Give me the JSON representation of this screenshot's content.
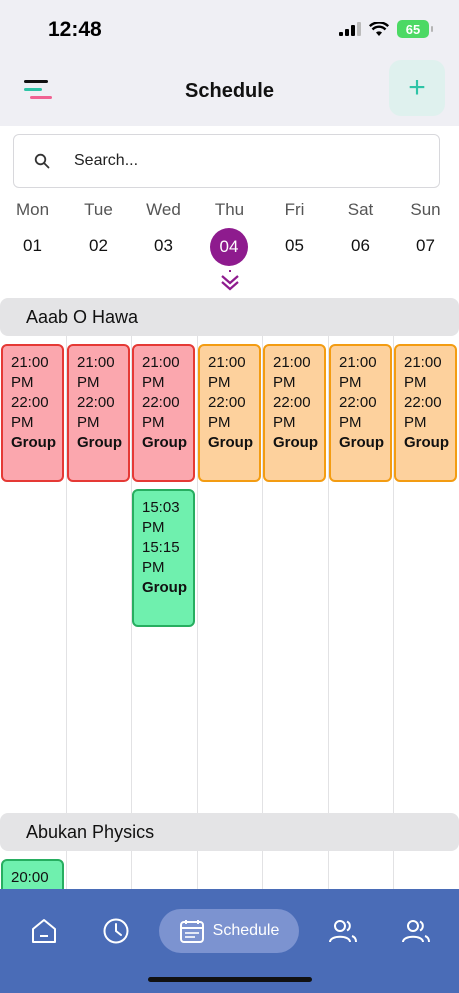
{
  "status": {
    "time": "12:48",
    "battery": "65"
  },
  "header": {
    "title": "Schedule",
    "add_label": "+"
  },
  "search": {
    "placeholder": "Search..."
  },
  "week": {
    "days": [
      {
        "name": "Mon",
        "num": "01"
      },
      {
        "name": "Tue",
        "num": "02"
      },
      {
        "name": "Wed",
        "num": "03"
      },
      {
        "name": "Thu",
        "num": "04"
      },
      {
        "name": "Fri",
        "num": "05"
      },
      {
        "name": "Sat",
        "num": "06"
      },
      {
        "name": "Sun",
        "num": "07"
      }
    ],
    "selected_index": 3
  },
  "groups": [
    {
      "name": "Aaab O Hawa",
      "events": [
        {
          "day": 0,
          "start": "21:00",
          "start_ampm": "PM",
          "end": "22:00",
          "end_ampm": "PM",
          "type": "Group",
          "color": "red"
        },
        {
          "day": 1,
          "start": "21:00",
          "start_ampm": "PM",
          "end": "22:00",
          "end_ampm": "PM",
          "type": "Group",
          "color": "red"
        },
        {
          "day": 2,
          "start": "21:00",
          "start_ampm": "PM",
          "end": "22:00",
          "end_ampm": "PM",
          "type": "Group",
          "color": "red"
        },
        {
          "day": 3,
          "start": "21:00",
          "start_ampm": "PM",
          "end": "22:00",
          "end_ampm": "PM",
          "type": "Group",
          "color": "orange"
        },
        {
          "day": 4,
          "start": "21:00",
          "start_ampm": "PM",
          "end": "22:00",
          "end_ampm": "PM",
          "type": "Group",
          "color": "orange"
        },
        {
          "day": 5,
          "start": "21:00",
          "start_ampm": "PM",
          "end": "22:00",
          "end_ampm": "PM",
          "type": "Group",
          "color": "orange"
        },
        {
          "day": 6,
          "start": "21:00",
          "start_ampm": "PM",
          "end": "22:00",
          "end_ampm": "PM",
          "type": "Group",
          "color": "orange"
        },
        {
          "day": 2,
          "start": "15:03",
          "start_ampm": "PM",
          "end": "15:15",
          "end_ampm": "PM",
          "type": "Group",
          "color": "green"
        }
      ]
    },
    {
      "name": "Abukan Physics",
      "events": [
        {
          "day": 0,
          "start": "20:00",
          "color": "green"
        }
      ]
    }
  ],
  "colors": {
    "red": "#fba7ae",
    "orange": "#fdd19d",
    "green": "#6ff0ae",
    "accent": "#8e1b8e",
    "tabbar": "#4a6cb7"
  },
  "tabbar": {
    "items": [
      {
        "icon": "home-icon"
      },
      {
        "icon": "clock-icon"
      },
      {
        "icon": "calendar-icon",
        "label": "Schedule",
        "active": true
      },
      {
        "icon": "users-icon"
      },
      {
        "icon": "users-icon"
      }
    ]
  }
}
